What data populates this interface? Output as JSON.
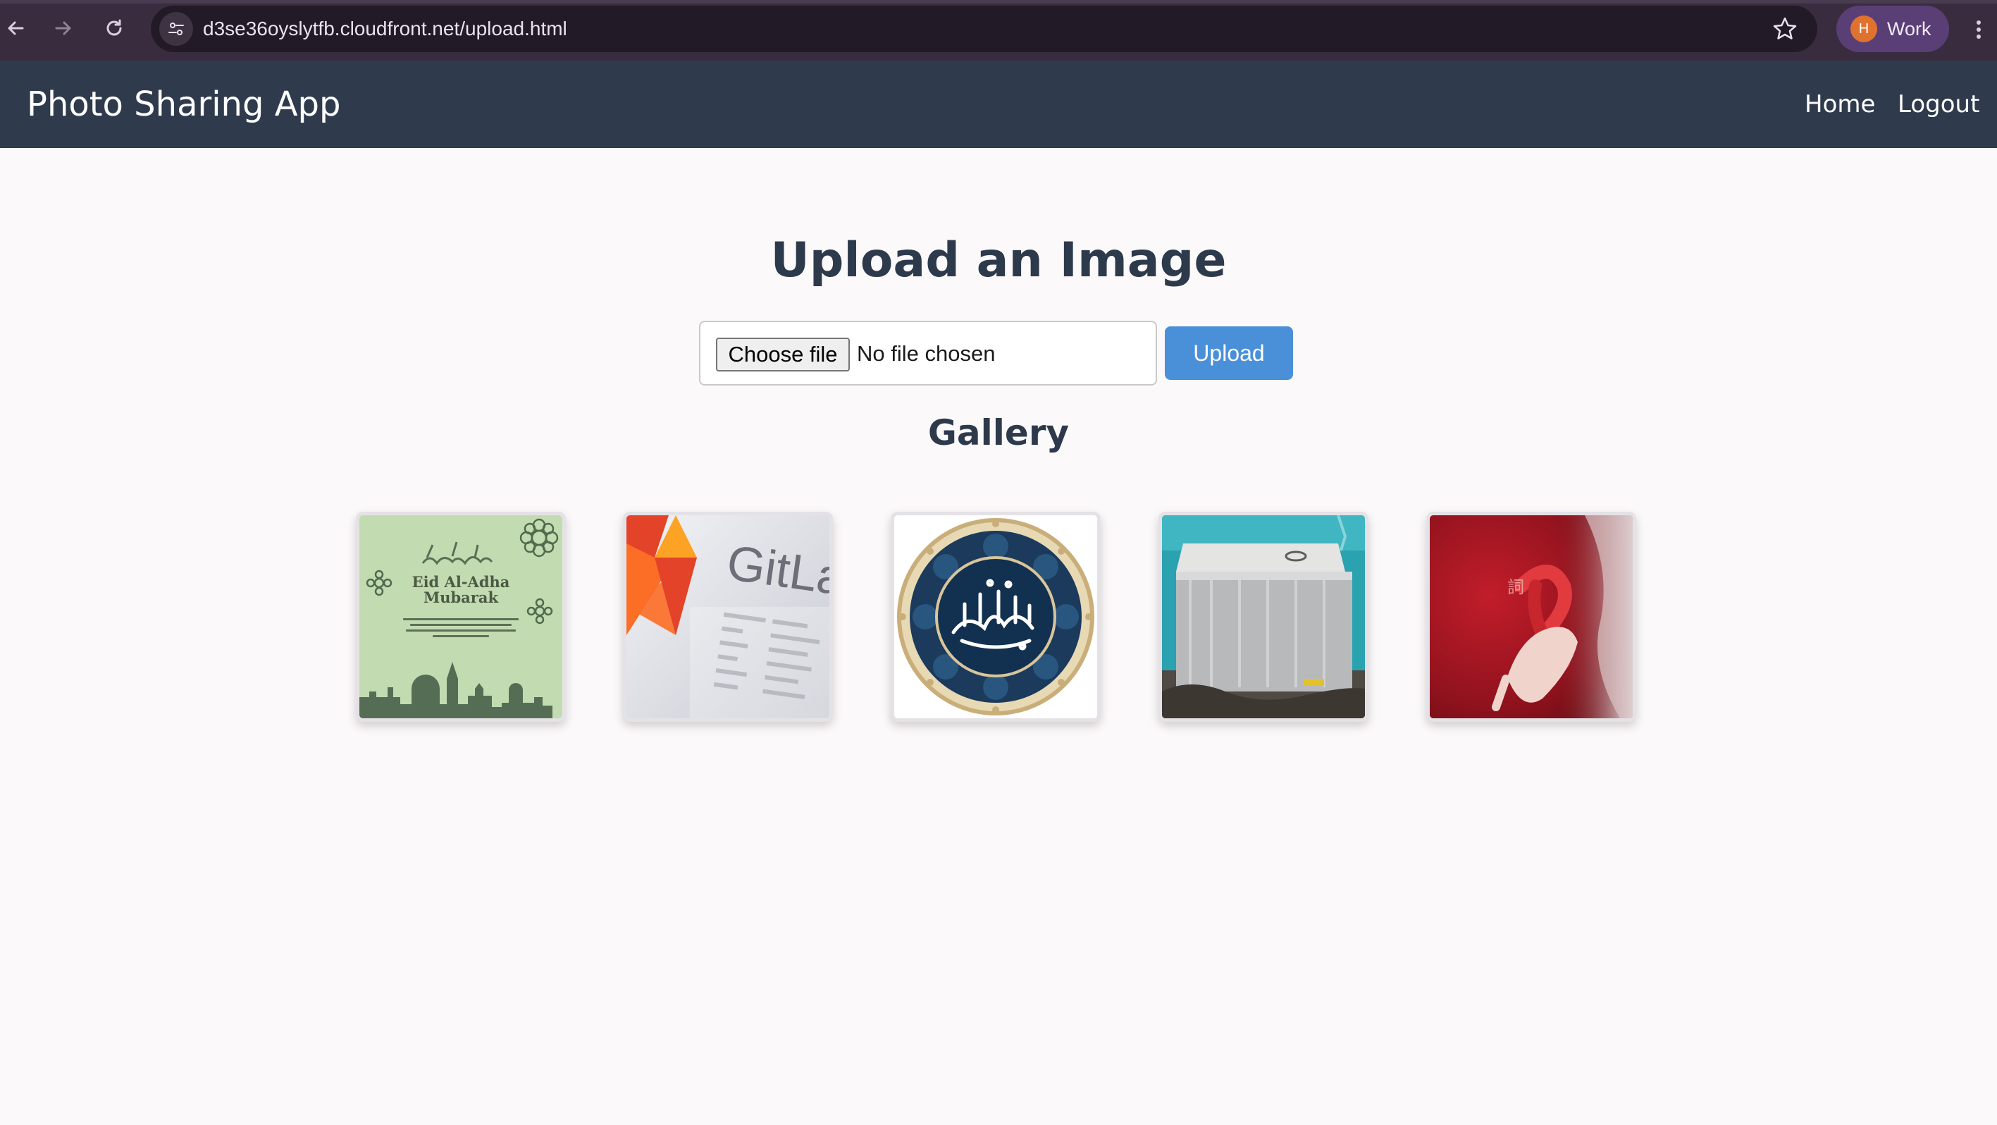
{
  "browser": {
    "url": "d3se36oyslytfb.cloudfront.net/upload.html",
    "profile_initial": "H",
    "profile_label": "Work",
    "icons": [
      "back-arrow-icon",
      "forward-arrow-icon",
      "reload-icon",
      "site-info-icon",
      "bookmark-star-icon",
      "more-vert-icon"
    ]
  },
  "appbar": {
    "brand": "Photo Sharing App",
    "links": [
      "Home",
      "Logout"
    ]
  },
  "upload": {
    "heading": "Upload an Image",
    "choose_label": "Choose file",
    "file_status": "No file chosen",
    "submit_label": "Upload"
  },
  "gallery": {
    "heading": "Gallery",
    "items": [
      {
        "subject": "Eid greeting card",
        "text": [
          "Eid Al-Adha",
          "Mubarak"
        ]
      },
      {
        "subject": "GitLab logo",
        "text": [
          "GitLab"
        ]
      },
      {
        "subject": "Quran calligraphy medallion"
      },
      {
        "subject": "stainless dishwasher photo"
      },
      {
        "subject": "red awareness ribbon photo"
      }
    ]
  },
  "colors": {
    "chrome": "#392c3f",
    "appbar": "#2f3b4d",
    "accent": "#4a90d9",
    "heading": "#2d3a4c",
    "page_bg": "#fcf9fa"
  }
}
